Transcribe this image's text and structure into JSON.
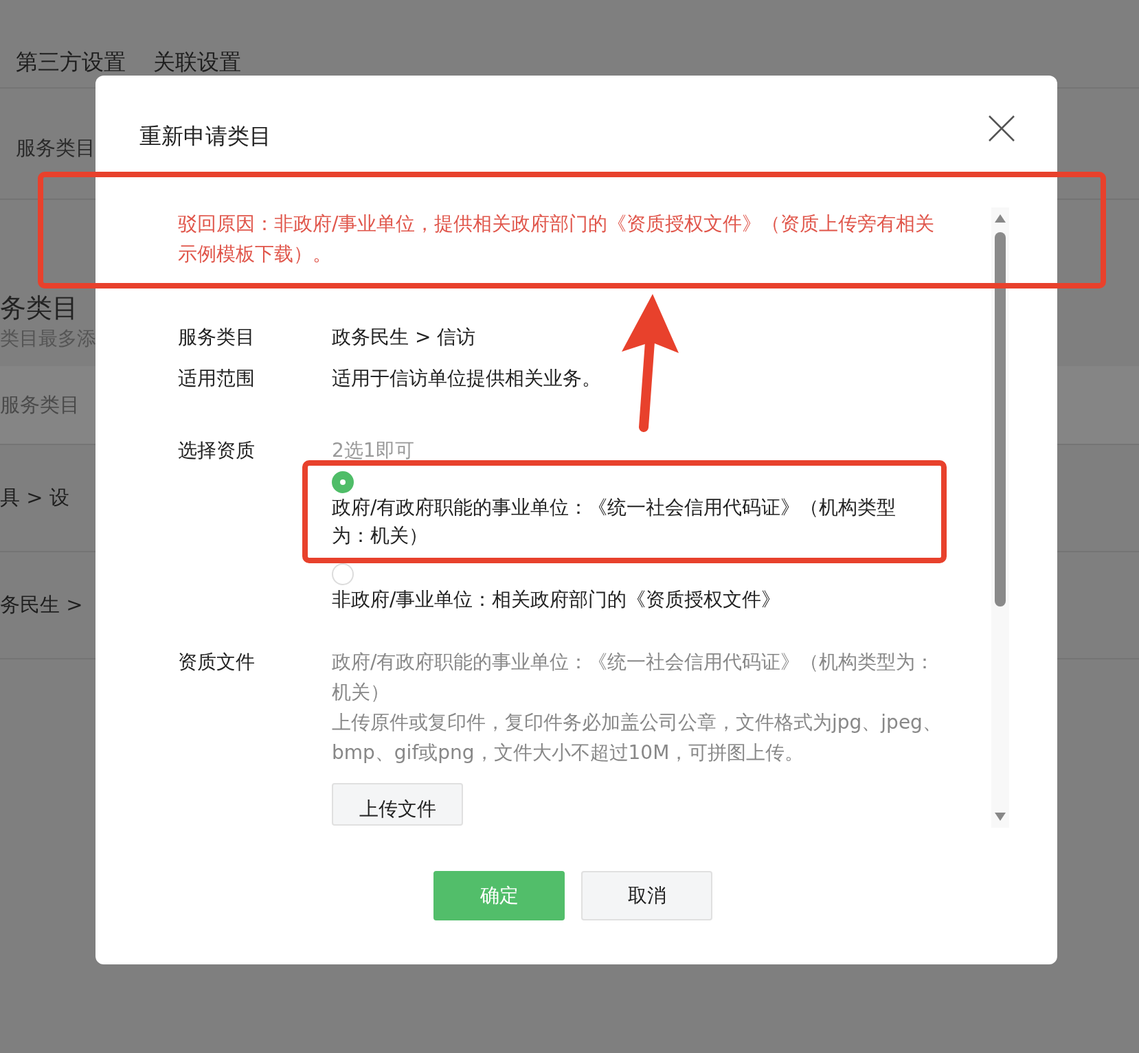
{
  "background_page": {
    "tabs": [
      "第三方设置",
      "关联设置"
    ],
    "breadcrumb": "服务类目",
    "heading": "务类目",
    "hint": "类目最多添",
    "rows": [
      {
        "kind": "band",
        "text": "服务类目"
      },
      {
        "kind": "row",
        "text": "具 > 设"
      },
      {
        "kind": "row",
        "text": "务民生 >"
      }
    ]
  },
  "dialog": {
    "title": "重新申请类目",
    "reject_reason": "驳回原因：非政府/事业单位，提供相关政府部门的《资质授权文件》（资质上传旁有相关示例模板下载）。",
    "fields": [
      {
        "label": "服务类目",
        "value": "政务民生 > 信访"
      },
      {
        "label": "适用范围",
        "value": "适用于信访单位提供相关业务。"
      }
    ],
    "qualification": {
      "label": "选择资质",
      "hint": "2选1即可",
      "options": [
        {
          "text": "政府/有政府职能的事业单位：《统一社会信用代码证》（机构类型为：机关）",
          "selected": true
        },
        {
          "text": "非政府/事业单位：相关政府部门的《资质授权文件》",
          "selected": false
        }
      ]
    },
    "files": {
      "label": "资质文件",
      "lines": [
        "政府/有政府职能的事业单位：《统一社会信用代码证》（机构类型为：机关）",
        "上传原件或复印件，复印件务必加盖公司公章，文件格式为jpg、jpeg、bmp、gif或png，文件大小不超过10M，可拼图上传。"
      ],
      "button": "上传文件"
    },
    "buttons": [
      {
        "label": "确定",
        "kind": "primary"
      },
      {
        "label": "取消",
        "kind": "default"
      }
    ]
  }
}
